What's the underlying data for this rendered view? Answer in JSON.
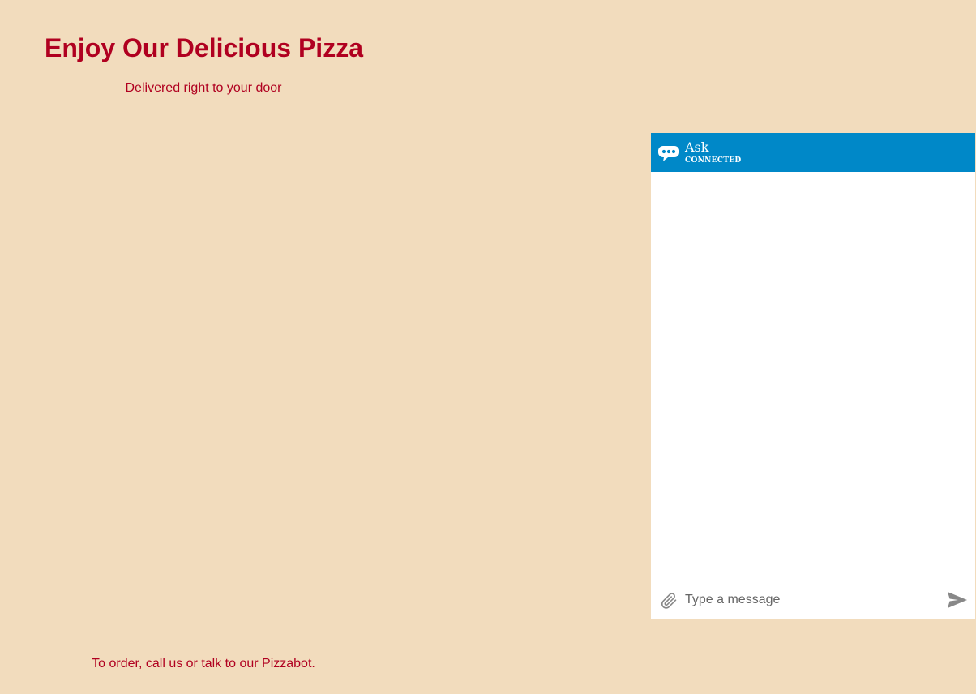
{
  "page": {
    "title": "Enjoy Our Delicious Pizza",
    "subtitle": "Delivered right to your door",
    "footer": "To order, call us or talk to our Pizzabot."
  },
  "chat": {
    "title": "Ask",
    "status": "CONNECTED",
    "input_placeholder": "Type a message",
    "input_value": "",
    "header_icon": "chat-bubble-icon",
    "attach_icon": "paperclip-icon",
    "send_icon": "send-icon"
  },
  "colors": {
    "page_background": "#f2dcbd",
    "brand_text": "#b00020",
    "chat_header": "#0088c8",
    "icon_gray": "#888888"
  }
}
